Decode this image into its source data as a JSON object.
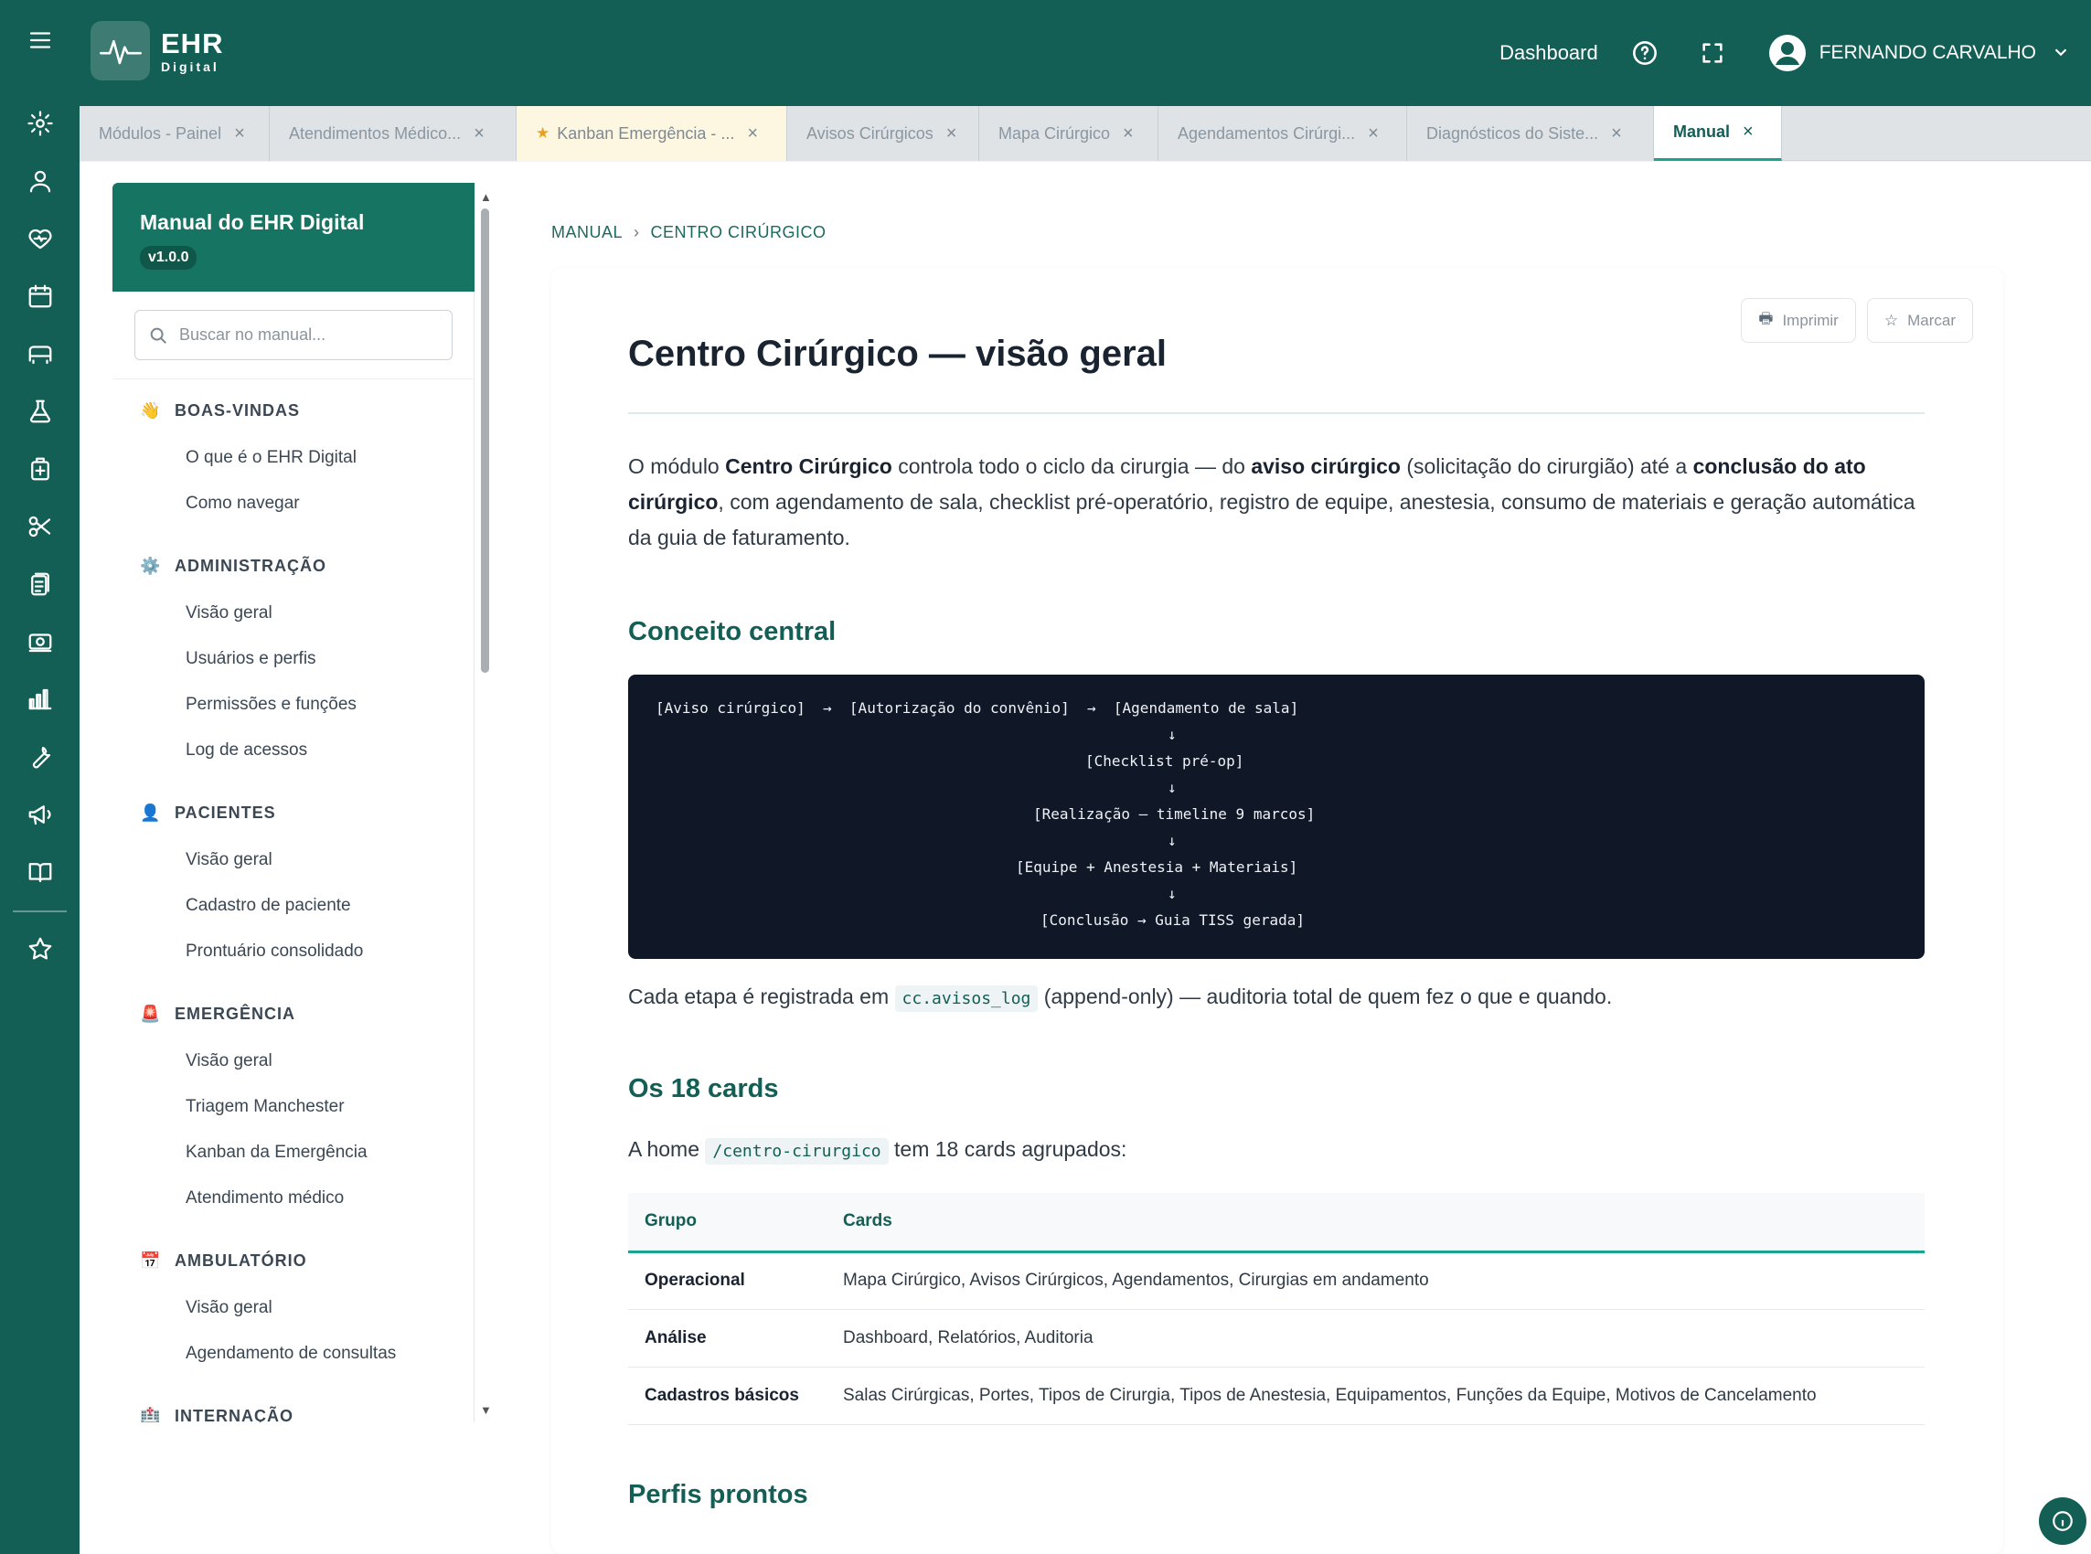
{
  "app": {
    "logo_main": "EHR",
    "logo_sub": "Digital"
  },
  "topbar": {
    "dashboard_label": "Dashboard",
    "user_name": "FERNANDO CARVALHO"
  },
  "rail_icons": [
    "gear-icon",
    "user-icon",
    "heart-pulse-icon",
    "calendar-icon",
    "bed-icon",
    "flask-icon",
    "medical-kit-icon",
    "scissors-icon",
    "clipboard-icon",
    "money-icon",
    "bar-chart-icon",
    "wrench-icon",
    "megaphone-icon",
    "book-icon",
    "star-icon"
  ],
  "tabs": [
    {
      "label": "Módulos - Painel"
    },
    {
      "label": "Atendimentos Médico..."
    },
    {
      "label": "Kanban Emergência - ..."
    },
    {
      "label": "Avisos Cirúrgicos"
    },
    {
      "label": "Mapa Cirúrgico"
    },
    {
      "label": "Agendamentos Cirúrgi..."
    },
    {
      "label": "Diagnósticos do Siste..."
    },
    {
      "label": "Manual"
    }
  ],
  "tab_close": "×",
  "sidebar": {
    "title": "Manual do EHR Digital",
    "version": "v1.0.0",
    "search_placeholder": "Buscar no manual...",
    "sections": [
      {
        "icon": "👋",
        "title": "BOAS-VINDAS",
        "items": [
          "O que é o EHR Digital",
          "Como navegar"
        ]
      },
      {
        "icon": "⚙️",
        "title": "ADMINISTRAÇÃO",
        "items": [
          "Visão geral",
          "Usuários e perfis",
          "Permissões e funções",
          "Log de acessos"
        ]
      },
      {
        "icon": "👤",
        "title": "PACIENTES",
        "items": [
          "Visão geral",
          "Cadastro de paciente",
          "Prontuário consolidado"
        ]
      },
      {
        "icon": "🚨",
        "title": "EMERGÊNCIA",
        "items": [
          "Visão geral",
          "Triagem Manchester",
          "Kanban da Emergência",
          "Atendimento médico"
        ]
      },
      {
        "icon": "📅",
        "title": "AMBULATÓRIO",
        "items": [
          "Visão geral",
          "Agendamento de consultas"
        ]
      },
      {
        "icon": "🏥",
        "title": "INTERNAÇÃO",
        "items": []
      }
    ]
  },
  "breadcrumb": {
    "root": "MANUAL",
    "current": "CENTRO CIRÚRGICO"
  },
  "actions": {
    "print": "Imprimir",
    "mark": "Marcar"
  },
  "article": {
    "title": "Centro Cirúrgico — visão geral",
    "intro_1": "O módulo ",
    "intro_b1": "Centro Cirúrgico",
    "intro_2": " controla todo o ciclo da cirurgia — do ",
    "intro_b2": "aviso cirúrgico",
    "intro_3": " (solicitação do cirurgião) até a ",
    "intro_b3": "conclusão do ato cirúrgico",
    "intro_4": ", com agendamento de sala, checklist pré-operatório, registro de equipe, anestesia, consumo de materiais e geração automática da guia de faturamento.",
    "h_concept": "Conceito central",
    "flow": [
      "[Aviso cirúrgico]  →  [Autorização do convênio]  →  [Agendamento de sala]",
      "↓",
      "[Checklist pré-op]",
      "↓",
      "[Realização — timeline 9 marcos]",
      "↓",
      "[Equipe + Anestesia + Materiais]",
      "↓",
      "[Conclusão → Guia TISS gerada]"
    ],
    "log_1": "Cada etapa é registrada em ",
    "log_code": "cc.avisos_log",
    "log_2": " (append-only) — auditoria total de quem fez o que e quando.",
    "h_cards": "Os 18 cards",
    "home_1": "A home ",
    "home_code": "/centro-cirurgico",
    "home_2": " tem 18 cards agrupados:",
    "table": {
      "headers": [
        "Grupo",
        "Cards"
      ],
      "rows": [
        [
          "Operacional",
          "Mapa Cirúrgico, Avisos Cirúrgicos, Agendamentos, Cirurgias em andamento"
        ],
        [
          "Análise",
          "Dashboard, Relatórios, Auditoria"
        ],
        [
          "Cadastros básicos",
          "Salas Cirúrgicas, Portes, Tipos de Cirurgia, Tipos de Anestesia, Equipamentos, Funções da Equipe, Motivos de Cancelamento"
        ]
      ]
    },
    "h_profiles": "Perfis prontos"
  }
}
